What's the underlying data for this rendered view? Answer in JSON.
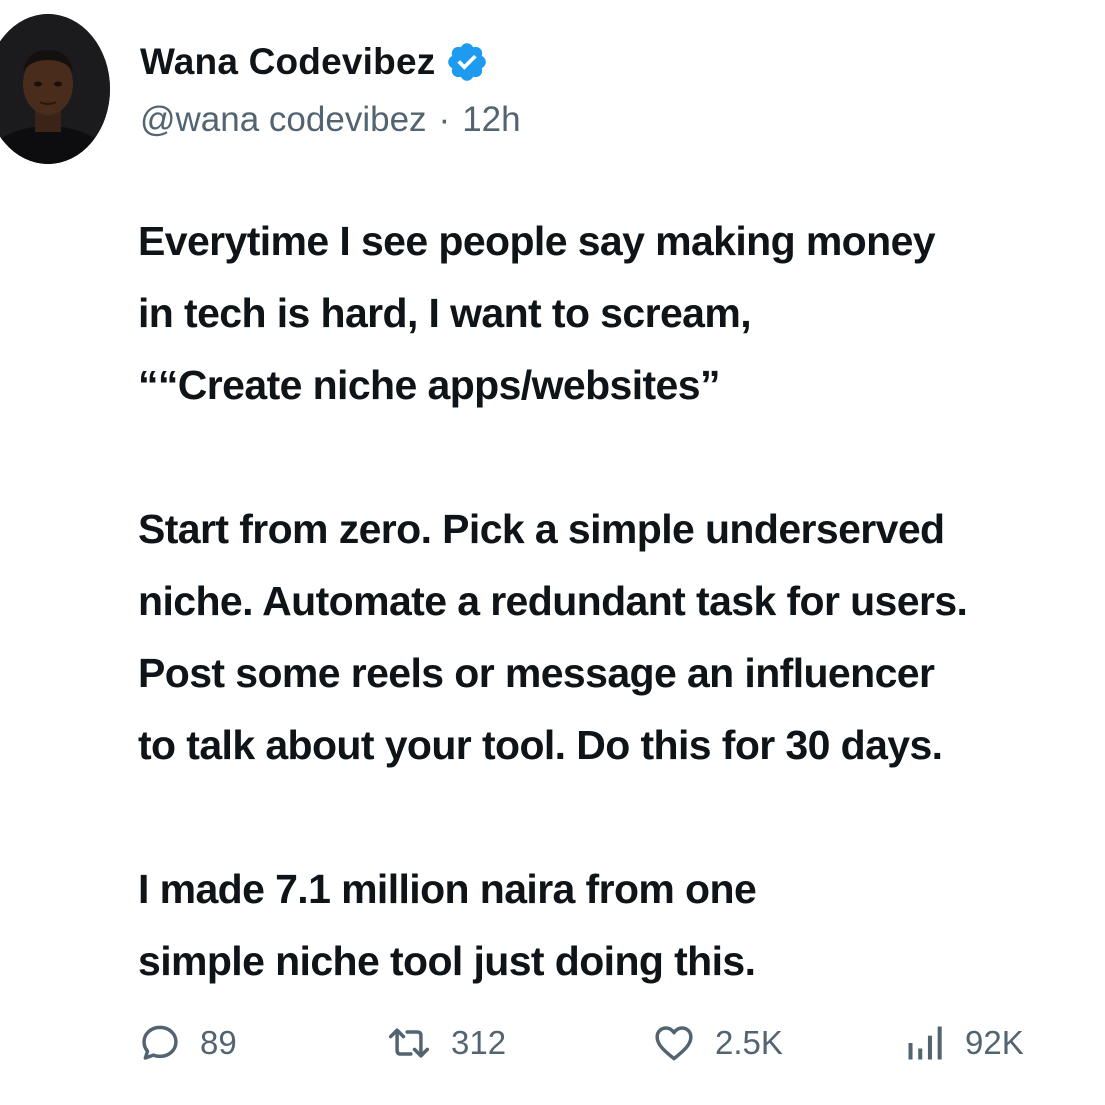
{
  "author": {
    "display_name": "Wana Codevibez",
    "handle": "@wana codevibez",
    "separator": "·",
    "time": "12h",
    "verified_color": "#1d9bf0"
  },
  "tweet": {
    "paragraphs": [
      {
        "lines": [
          "Everytime I see people say making money",
          "in tech is hard, I want to scream,",
          "““Create niche apps/websites”"
        ]
      },
      {
        "lines": [
          "Start from zero. Pick a simple underserved",
          "niche. Automate a redundant task for users.",
          "Post some reels or message an influencer",
          "to talk about your tool. Do this for 30 days."
        ]
      },
      {
        "lines": [
          "I made 7.1 million naira from one",
          "simple niche tool just doing this."
        ]
      }
    ]
  },
  "actions": {
    "reply": {
      "icon": "reply-icon",
      "count": "89"
    },
    "retweet": {
      "icon": "retweet-icon",
      "count": "312"
    },
    "like": {
      "icon": "heart-icon",
      "count": "2.5K"
    },
    "views": {
      "icon": "views-chart-icon",
      "count": "92K"
    }
  },
  "colors": {
    "text_primary": "#0f1419",
    "text_secondary": "#536471",
    "background": "#ffffff"
  }
}
